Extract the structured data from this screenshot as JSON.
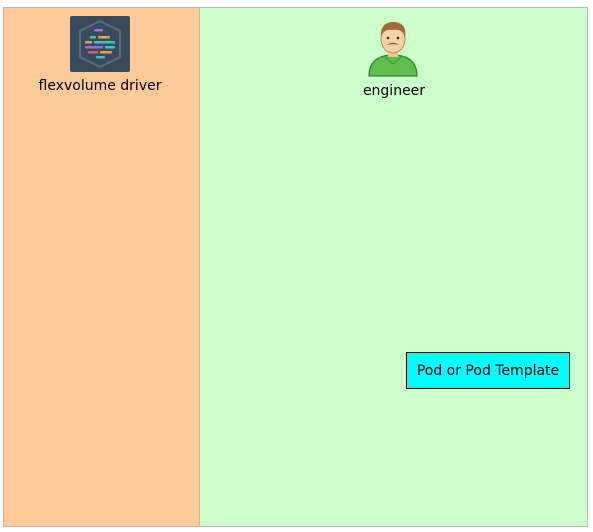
{
  "lanes": {
    "left": {
      "color": "#ffca99"
    },
    "right": {
      "color": "#ccffcc"
    }
  },
  "actors": {
    "driver": {
      "label": "flexvolume driver",
      "icon": "code-hexagon-icon"
    },
    "engineer": {
      "label": "engineer",
      "icon": "person-icon"
    }
  },
  "nodes": {
    "pod": {
      "label": "Pod or Pod Template",
      "color": "#00ffff"
    }
  }
}
